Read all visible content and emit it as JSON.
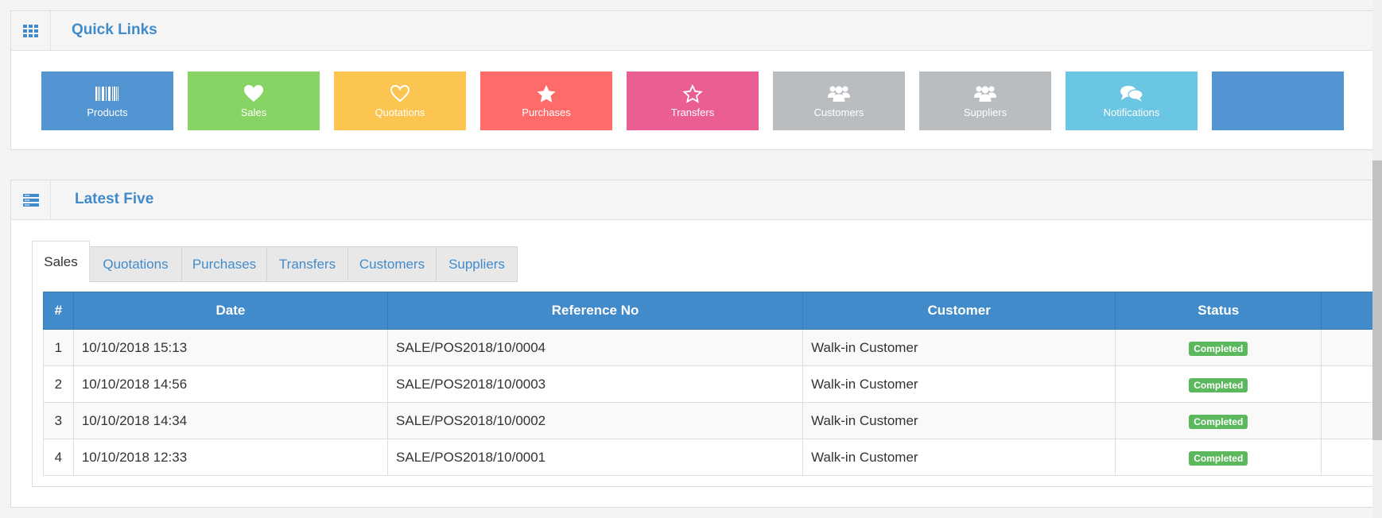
{
  "quick_links": {
    "title": "Quick Links",
    "icon": "grid-icon",
    "items": [
      {
        "label": "Products",
        "icon": "barcode-icon",
        "color": "#5395d3"
      },
      {
        "label": "Sales",
        "icon": "heart-icon",
        "color": "#87d465"
      },
      {
        "label": "Quotations",
        "icon": "heart-outline-icon",
        "color": "#fcc450"
      },
      {
        "label": "Purchases",
        "icon": "star-icon",
        "color": "#fe6b68"
      },
      {
        "label": "Transfers",
        "icon": "star-outline-icon",
        "color": "#eb5e94"
      },
      {
        "label": "Customers",
        "icon": "users-icon",
        "color": "#b9bdc0"
      },
      {
        "label": "Suppliers",
        "icon": "users-icon",
        "color": "#b9bdc0"
      },
      {
        "label": "Notifications",
        "icon": "comments-icon",
        "color": "#6ac6e3"
      },
      {
        "label": "",
        "icon": "",
        "color": "#5395d3"
      }
    ]
  },
  "latest_five": {
    "title": "Latest Five",
    "icon": "list-icon",
    "tabs": [
      "Sales",
      "Quotations",
      "Purchases",
      "Transfers",
      "Customers",
      "Suppliers"
    ],
    "active_tab": "Sales",
    "columns": [
      "#",
      "Date",
      "Reference No",
      "Customer",
      "Status",
      ""
    ],
    "rows": [
      {
        "num": "1",
        "date": "10/10/2018 15:13",
        "ref": "SALE/POS2018/10/0004",
        "customer": "Walk-in Customer",
        "status": "Completed"
      },
      {
        "num": "2",
        "date": "10/10/2018 14:56",
        "ref": "SALE/POS2018/10/0003",
        "customer": "Walk-in Customer",
        "status": "Completed"
      },
      {
        "num": "3",
        "date": "10/10/2018 14:34",
        "ref": "SALE/POS2018/10/0002",
        "customer": "Walk-in Customer",
        "status": "Completed"
      },
      {
        "num": "4",
        "date": "10/10/2018 12:33",
        "ref": "SALE/POS2018/10/0001",
        "customer": "Walk-in Customer",
        "status": "Completed"
      }
    ],
    "colors": {
      "header": "#428bca",
      "badge": "#5cb85c",
      "title": "#428bca"
    }
  }
}
